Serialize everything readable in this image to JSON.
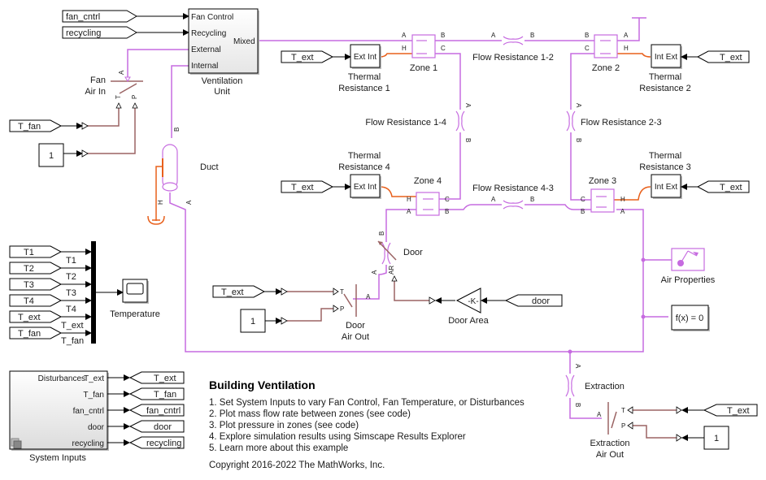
{
  "model": {
    "title": "Building Ventilation",
    "colors": {
      "physical_connection": "#c66be0",
      "thermal_connection": "#e8601c",
      "physical_signal": "#9b6464",
      "signal": "#000000"
    }
  },
  "ventilation_unit": {
    "label_line1": "Ventilation",
    "label_line2": "Unit",
    "ports": {
      "fan_control": "Fan Control",
      "recycling": "Recycling",
      "external": "External",
      "internal": "Internal",
      "mixed": "Mixed"
    }
  },
  "goto_from": {
    "fan_cntrl_in": "fan_cntrl",
    "recycling_in": "recycling",
    "t_ext": "T_ext",
    "t_fan": "T_fan",
    "door": "door"
  },
  "constants": {
    "one": "1"
  },
  "fan_air_in": {
    "line1": "Fan",
    "line2": "Air In",
    "port_a": "A",
    "port_t": "T",
    "port_p": "P"
  },
  "duct": {
    "label": "Duct",
    "port_a": "A",
    "port_b": "B",
    "port_h": "H"
  },
  "zones": [
    {
      "label": "Zone 1",
      "ports": [
        "A",
        "B",
        "H",
        "C"
      ]
    },
    {
      "label": "Zone 2",
      "ports": [
        "B",
        "A",
        "C",
        "H"
      ]
    },
    {
      "label": "Zone 3",
      "ports": [
        "C",
        "H",
        "B",
        "A"
      ]
    },
    {
      "label": "Zone 4",
      "ports": [
        "H",
        "C",
        "A",
        "B"
      ]
    }
  ],
  "thermal_resistances": [
    {
      "line1": "Thermal",
      "line2": "Resistance 1",
      "ports": "Ext Int"
    },
    {
      "line1": "Thermal",
      "line2": "Resistance 2",
      "ports": "Int Ext"
    },
    {
      "line1": "Thermal",
      "line2": "Resistance 3",
      "ports": "Int Ext"
    },
    {
      "line1": "Thermal",
      "line2": "Resistance 4",
      "ports": "Ext Int"
    }
  ],
  "flow_resistances": {
    "r12": "Flow Resistance 1-2",
    "r14": "Flow Resistance 1-4",
    "r23": "Flow Resistance 2-3",
    "r43": "Flow Resistance 4-3",
    "port_a": "A",
    "port_b": "B"
  },
  "door": {
    "label": "Door",
    "port_a": "A",
    "port_b": "B",
    "port_ar": "AR"
  },
  "door_area": {
    "label": "Door Area",
    "gain": "-K-"
  },
  "door_air_out": {
    "line1": "Door",
    "line2": "Air Out",
    "port_t": "T",
    "port_p": "P",
    "port_a": "A"
  },
  "air_properties": {
    "label": "Air Properties"
  },
  "solver": {
    "label": "f(x) = 0"
  },
  "extraction": {
    "label": "Extraction",
    "port_a": "A",
    "port_b": "B"
  },
  "extraction_air_out": {
    "line1": "Extraction",
    "line2": "Air Out",
    "port_a": "A",
    "port_t": "T",
    "port_p": "P"
  },
  "scope": {
    "label": "Temperature",
    "inputs": [
      "T1",
      "T2",
      "T3",
      "T4",
      "T_ext",
      "T_fan"
    ]
  },
  "system_inputs": {
    "label": "System Inputs",
    "outputs": [
      "T_ext",
      "T_fan",
      "fan_cntrl",
      "door",
      "recycling"
    ],
    "first_output_prefix": "Disturbances",
    "goto_tags": [
      "T_ext",
      "T_fan",
      "fan_cntrl",
      "door",
      "recycling"
    ]
  },
  "annotation": {
    "title": "Building Ventilation",
    "items": [
      "1. Set System Inputs to vary Fan Control, Fan Temperature, or Disturbances",
      "2. Plot mass flow rate between zones (see code)",
      "3. Plot pressure in zones (see code)",
      "4. Explore simulation results using Simscape Results Explorer",
      "5. Learn more about this example"
    ],
    "copyright": "Copyright 2016-2022 The MathWorks, Inc."
  }
}
